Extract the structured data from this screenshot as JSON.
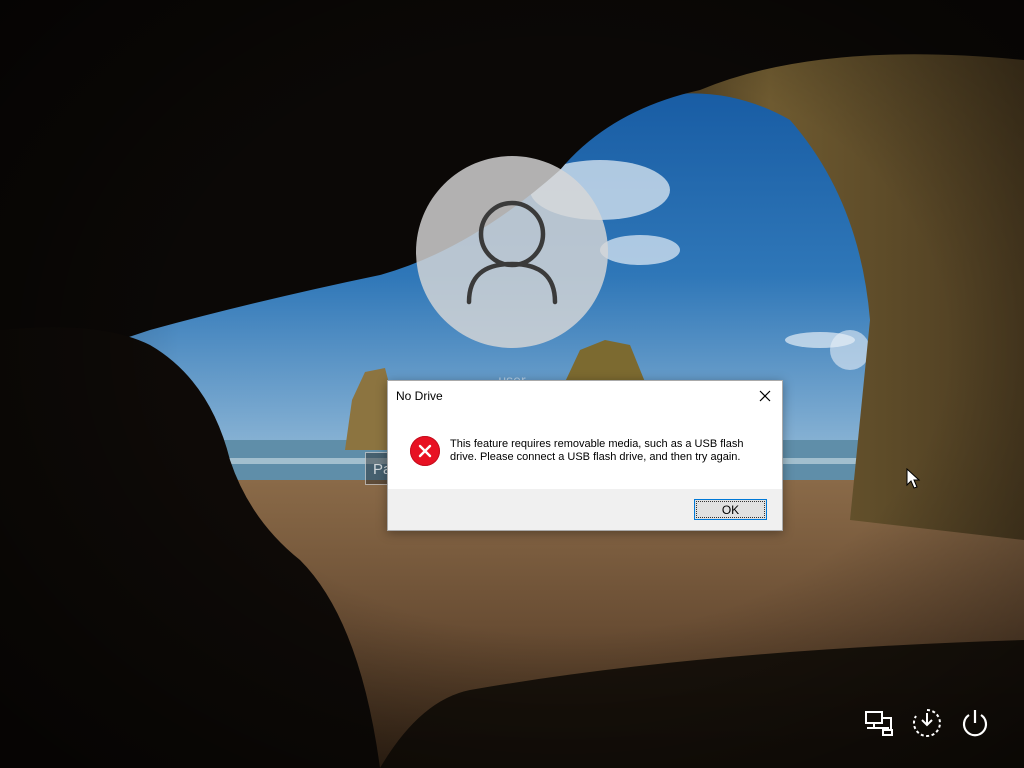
{
  "lock_screen": {
    "username": "user",
    "password_placeholder": "Password"
  },
  "dialog": {
    "title": "No Drive",
    "message": "This feature requires removable media, such as a USB flash drive. Please connect a USB flash drive, and then try again.",
    "ok_label": "OK",
    "error_icon": "error-x-icon"
  },
  "system_icons": [
    "network-icon",
    "ease-of-access-icon",
    "power-icon"
  ],
  "colors": {
    "error_red": "#e81123",
    "button_focus_border": "#0078d7",
    "dialog_footer": "#f0f0f0"
  }
}
